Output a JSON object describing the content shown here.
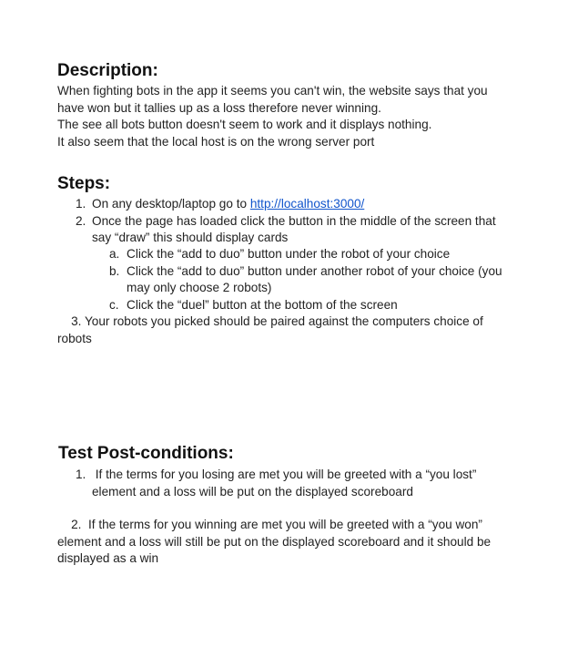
{
  "description": {
    "heading": "Description:",
    "lines": [
      "When fighting bots in the app it seems you can't win, the website says that you",
      "have won but it tallies up as a loss therefore never winning.",
      "The see all bots button doesn't seem to work and it displays nothing.",
      "It also seem that the local host is on the wrong server port"
    ]
  },
  "steps": {
    "heading": "Steps:",
    "step1": {
      "marker": "1.",
      "text": "On any desktop/laptop go to ",
      "link": "http://localhost:3000/"
    },
    "step2": {
      "marker": "2.",
      "line1": "Once the page has loaded click the button in the middle of the screen that",
      "line2": "say “draw” this should display cards"
    },
    "substeps": [
      {
        "marker": "a.",
        "line1": "Click the “add to duo” button under the robot of your choice",
        "line2": ""
      },
      {
        "marker": "b.",
        "line1": "Click the “add to duo” button under another robot of your choice (you",
        "line2": "may only choose 2 robots)"
      },
      {
        "marker": "c.",
        "line1": "Click the “duel” button at the bottom of the screen",
        "line2": ""
      }
    ],
    "step3": {
      "line1": "    3. Your robots you picked should be paired against the computers choice of",
      "line2": "robots"
    }
  },
  "postconditions": {
    "heading": "Test Post-conditions:",
    "item1": {
      "marker": "1.",
      "line1": " If the terms for you losing are met you will be greeted with a “you lost”",
      "line2": "element and a loss will be put on the displayed scoreboard"
    },
    "item2": {
      "line1": "    2.  If the terms for you winning are met you will be greeted with a “you won”",
      "line2": "element and a loss will still be put on the displayed scoreboard and it should be",
      "line3": "displayed as a win"
    }
  }
}
